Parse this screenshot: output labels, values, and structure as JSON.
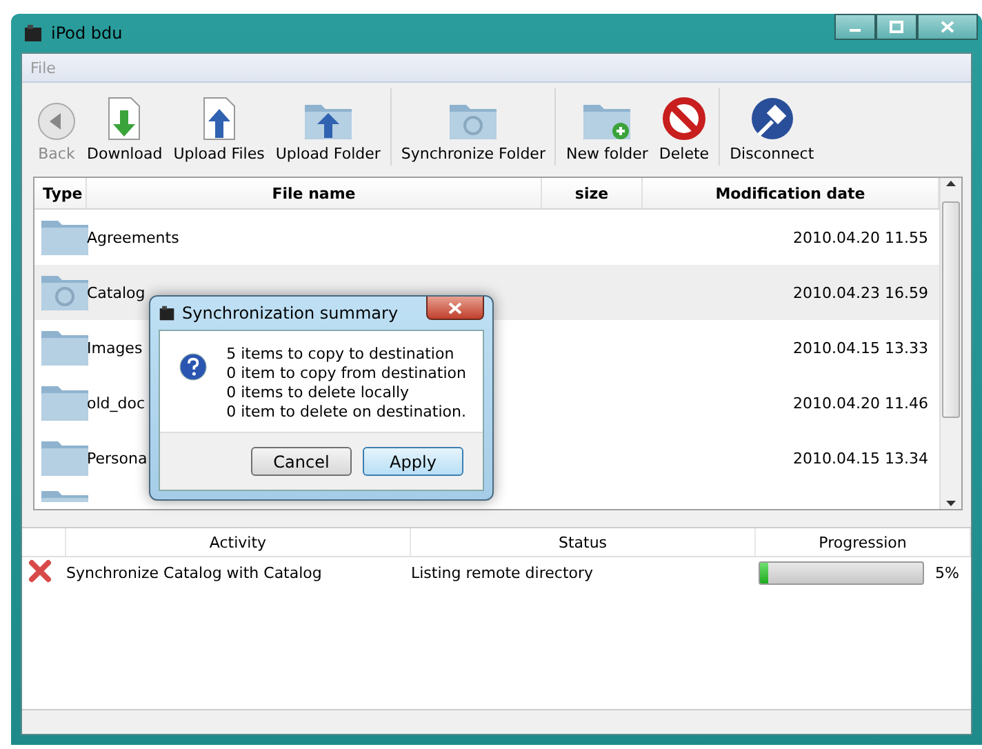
{
  "window": {
    "title": "iPod bdu"
  },
  "menu": [
    {
      "label": "File",
      "disabled": true
    }
  ],
  "toolbar": [
    [
      {
        "label": "Back",
        "kind": "back",
        "disabled": true
      },
      {
        "label": "Download",
        "kind": "download",
        "disabled": false
      },
      {
        "label": "Upload Files",
        "kind": "upload-file",
        "disabled": false
      },
      {
        "label": "Upload Folder",
        "kind": "upload-folder",
        "disabled": false
      }
    ],
    [
      {
        "label": "Synchronize Folder",
        "kind": "sync-folder",
        "disabled": false
      }
    ],
    [
      {
        "label": "New folder",
        "kind": "new-folder",
        "disabled": false
      },
      {
        "label": "Delete",
        "kind": "delete",
        "disabled": false
      }
    ],
    [
      {
        "label": "Disconnect",
        "kind": "disconnect",
        "disabled": false
      }
    ]
  ],
  "files": {
    "columns": [
      "Type",
      "File name",
      "size",
      "Modification date"
    ],
    "rows": [
      {
        "kind": "folder",
        "name": "Agreements",
        "date": "2010.04.20 11.55",
        "selected": false
      },
      {
        "kind": "sync-folder",
        "name": "Catalog",
        "date": "2010.04.23 16.59",
        "selected": true
      },
      {
        "kind": "folder",
        "name": "Images",
        "date": "2010.04.15 13.33",
        "selected": false
      },
      {
        "kind": "folder",
        "name": "old_doc",
        "date": "2010.04.20 11.46",
        "selected": false
      },
      {
        "kind": "folder",
        "name": "Persona",
        "date": "2010.04.15 13.34",
        "selected": false
      }
    ]
  },
  "dialog": {
    "title": "Synchronization summary",
    "lines": [
      "5 items to copy to destination",
      "0 item to copy from destination",
      "0 items to delete locally",
      "0 item to delete on destination."
    ],
    "buttons": [
      {
        "label": "Cancel",
        "selected": false
      },
      {
        "label": "Apply",
        "selected": true
      }
    ]
  },
  "activities": {
    "columns": [
      "Activity",
      "Status",
      "Progression"
    ],
    "rows": [
      {
        "kind": "error",
        "activity": "Synchronize Catalog with Catalog",
        "status": "Listing remote directory",
        "level": 0.05,
        "reading": "5%"
      }
    ]
  }
}
